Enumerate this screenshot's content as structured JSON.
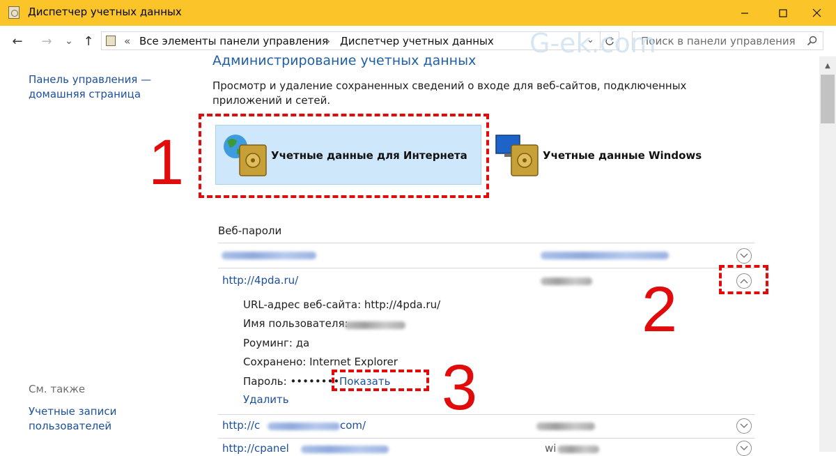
{
  "window": {
    "title": "Диспетчер учетных данных",
    "controls": {
      "minimize": "—",
      "maximize": "☐",
      "close": "✕"
    }
  },
  "nav": {
    "back": "←",
    "forward": "→",
    "recent": "⌄",
    "up": "↑"
  },
  "address": {
    "crumbs_sep_start": "«",
    "crumb_1": "Все элементы панели управления",
    "sep": "›",
    "crumb_2": "Диспетчер учетных данных",
    "dropdown": "⌄"
  },
  "search": {
    "placeholder": "Поиск в панели управления"
  },
  "watermark": "G-ek.com",
  "sidebar": {
    "home_link_line1": "Панель управления —",
    "home_link_line2": "домашняя страница",
    "see_also": "См. также",
    "user_accounts_line1": "Учетные записи",
    "user_accounts_line2": "пользователей"
  },
  "main": {
    "heading": "Администрирование учетных данных",
    "description": "Просмотр и удаление сохраненных сведений о входе для веб-сайтов, подключенных приложений и сетей.",
    "tiles": {
      "internet": "Учетные данные для Интернета",
      "windows": "Учетные данные Windows"
    },
    "section_title": "Веб-пароли",
    "entries": [
      {
        "url": "",
        "user": "",
        "expanded": false
      },
      {
        "url": "http://4pda.ru/",
        "user": "",
        "expanded": true
      },
      {
        "url": "http://c",
        "url_suffix": "com/",
        "user": "",
        "expanded": false
      },
      {
        "url": "http://cpanel",
        "user": "wi",
        "expanded": false
      }
    ],
    "details": {
      "url_label": "URL-адрес веб-сайта:",
      "url_value": "http://4pda.ru/",
      "username_label": "Имя пользователя:",
      "roaming_label": "Роуминг:",
      "roaming_value": "да",
      "saved_label": "Сохранено:",
      "saved_value": "Internet Explorer",
      "password_label": "Пароль:",
      "password_mask": "••••••••",
      "show_link": "Показать",
      "delete_link": "Удалить"
    }
  },
  "annotations": {
    "one": "1",
    "two": "2",
    "three": "3"
  },
  "colors": {
    "titlebar": "#fbc52a",
    "link": "#1c4f9c",
    "heading": "#1f5fa6",
    "annotation": "#e10b0b",
    "tile_selected": "#cfe7fa"
  }
}
